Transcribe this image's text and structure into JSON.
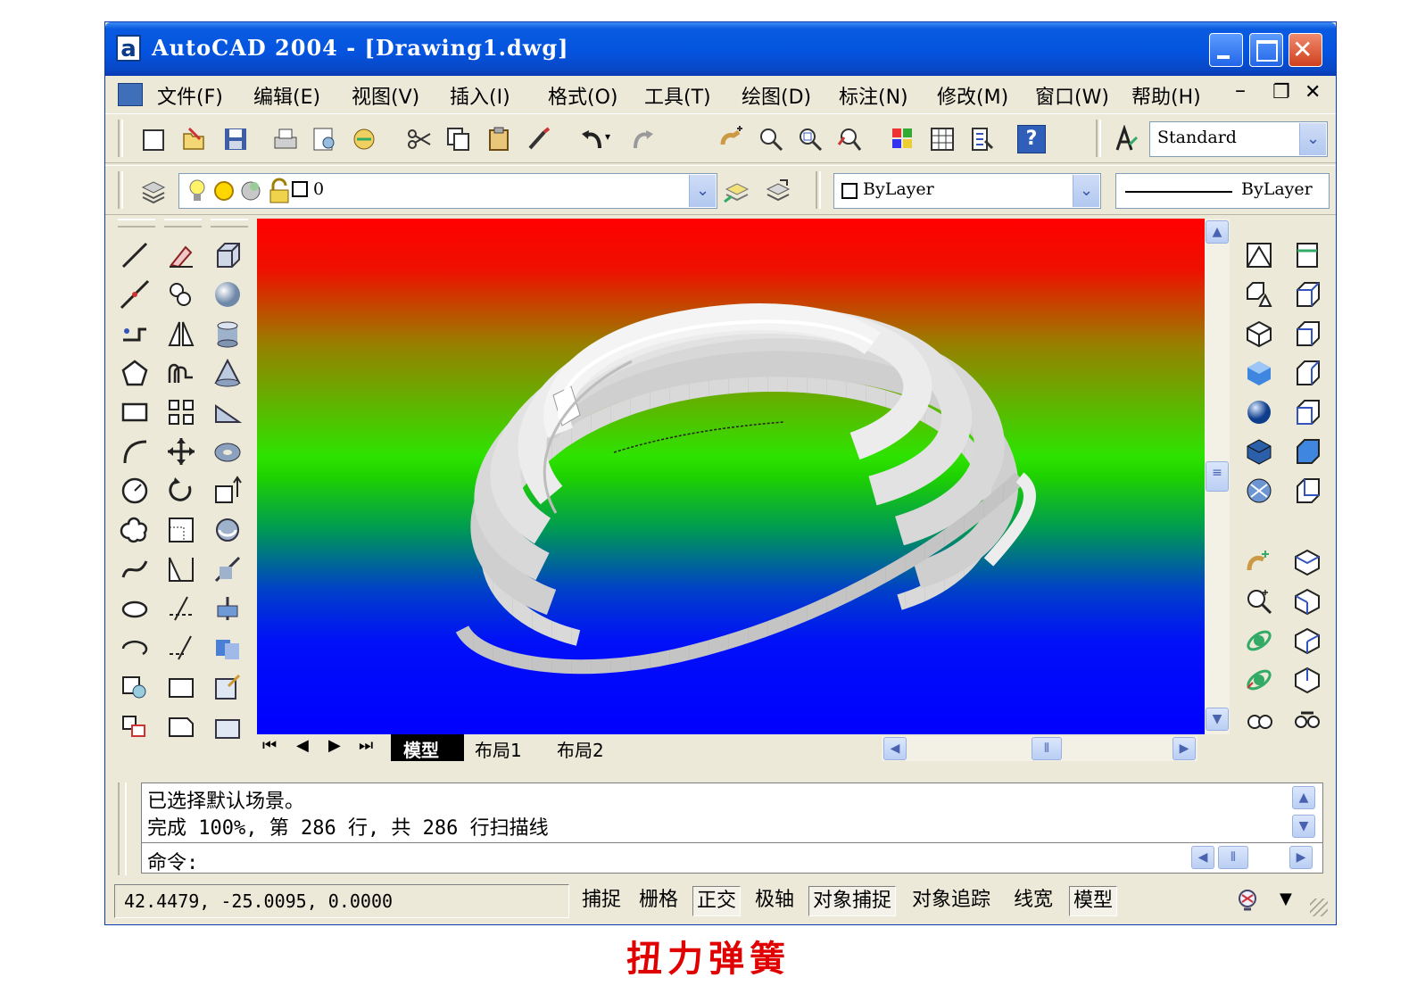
{
  "window": {
    "title": "AutoCAD 2004 - [Drawing1.dwg]",
    "app_icon": "a"
  },
  "menu": [
    "文件(F)",
    "编辑(E)",
    "视图(V)",
    "插入(I)",
    "格式(O)",
    "工具(T)",
    "绘图(D)",
    "标注(N)",
    "修改(M)",
    "窗口(W)",
    "帮助(H)"
  ],
  "toolbar": {
    "text_style": "Standard",
    "layer_value": "0",
    "color_value": "ByLayer",
    "linetype_value": "ByLayer"
  },
  "tabs": [
    "模型",
    "布局1",
    "布局2"
  ],
  "command": {
    "lines": [
      "已选择默认场景。",
      "完成 100%, 第 286 行, 共 286 行扫描线"
    ],
    "prompt": "命令:"
  },
  "status": {
    "coords": "42.4479,   -25.0095,  0.0000",
    "buttons": [
      "捕捉",
      "栅格",
      "正交",
      "极轴",
      "对象捕捉",
      "对象追踪",
      "线宽",
      "模型"
    ]
  },
  "caption": "扭力弹簧",
  "colors": {
    "title_blue": "#0454e0",
    "caption_red": "#e00000",
    "chrome": "#ece9d8"
  }
}
